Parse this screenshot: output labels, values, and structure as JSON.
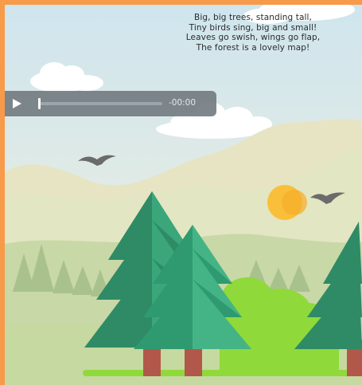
{
  "poem": {
    "line1": "Big, big trees, standing tall,",
    "line2": "Tiny birds sing, big and small!",
    "line3": "Leaves go swish, wings go flap,",
    "line4": "The forest is a lovely map!"
  },
  "player": {
    "play_icon": "play-icon",
    "time": "-00:00",
    "progress": 0
  },
  "colors": {
    "frame": "#f79a4a",
    "sky": "#d7ebf0",
    "pine_dark": "#2e8b66",
    "pine_light": "#3aa67a",
    "bush": "#8fd93a",
    "sun": "#f9bf3b",
    "bird": "#6b6b6b"
  }
}
